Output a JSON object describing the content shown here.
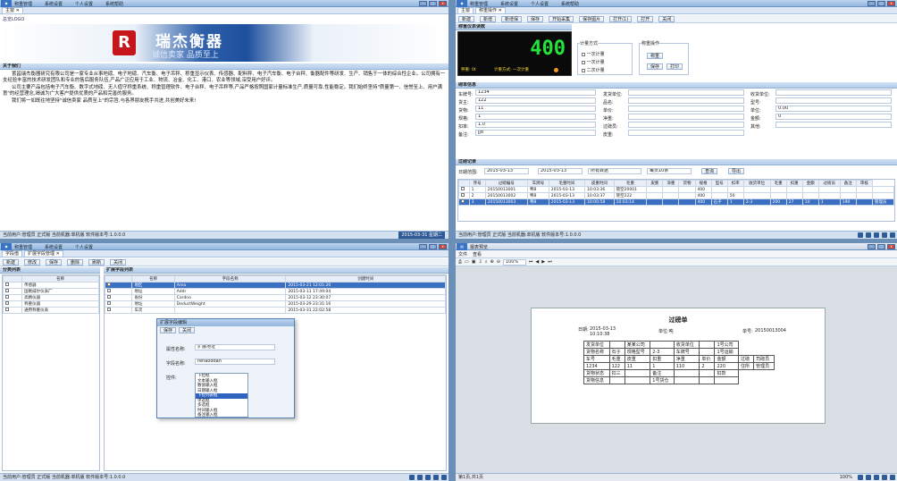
{
  "q1": {
    "menu": [
      "称重管理",
      "系统设置",
      "个人设置",
      "系统帮助"
    ],
    "tab": "主窗 ✕",
    "breadcrumb": "总览LOGO",
    "brand": "瑞杰衡器",
    "slogan": "诚信卖家 品质至上",
    "about": "关于我们",
    "p1": "置昌瑞杰衡器研究有限公司是一家专业从事地磅、电子地磅、汽车衡、电子吊秤、称重显示仪表、传感器、配料秤、电子汽车衡、电子台秤、衡器配件等研发、生产、销售于一体的综合性企业。公司拥有一支经验丰富的技术研发团队和专业的售后服务队伍,产品广泛应用于工业、物流、冶金、化工、港口、农业等领域,深受用户好评。",
    "p2": "公司主要产品包括电子汽车衡、数字式地磅、无人值守称重系统、称重管理软件、电子台秤、电子吊秤等,产品严格按照国家计量标准生产,质量可靠,性能稳定。我们始终坚持\"质量第一、信誉至上、用户满意\"的经营理念,竭诚为广大客户提供优质的产品和完善的服务。",
    "p3": "我们将一如既往地坚持\"诚信卖家 品质至上\"的宗旨,与各界朋友携手共进,共创美好未来!",
    "status": "当前用户:管理员 正式版 当前机器:单机版 软件版本号:1.0.0.0",
    "clock": "2015-03-31 星期二"
  },
  "q2": {
    "menu": [
      "称重管理",
      "系统设置",
      "个人设置",
      "系统帮助"
    ],
    "tabs": [
      "主窗",
      "称重操作 ✕"
    ],
    "toolbar": [
      "新建",
      "新增",
      "新增保",
      "保存",
      "开始采集",
      "保存图片",
      "打开(1)",
      "打开",
      "关闭"
    ],
    "weighing": "称重仪表读数",
    "weight": "400",
    "scale": "秤重: 0t",
    "mode": "计重方式: 一次计重",
    "modes": {
      "t": "计量方式",
      "a": "一次计量",
      "b": "一次计量",
      "c": "二次计量"
    },
    "ops": {
      "t": "称重操作",
      "a": "称重",
      "b": "保存",
      "c": "打印"
    },
    "form_title": "磅单信息",
    "f": {
      "chepai": "车牌号:",
      "chepai_v": "1234",
      "huozhu": "货主:",
      "huozhu_v": "122",
      "huowu": "货物:",
      "huowu_v": "11",
      "guige": "规格:",
      "guige_v": "1",
      "koulv": "扣率:",
      "koulv_v": "1.0",
      "beizhu": "备注:",
      "beizhu_v": "jjd",
      "fahuo": "发货单位:",
      "pinming": "品名:",
      "shouhuo": "收货单位:",
      "danjia": "单价:",
      "jingzhong": "净重:",
      "maozhong": "毛重:",
      "pizhong": "皮重:",
      "guobang": "过磅员:",
      "shouhuodw": "收货单位:",
      "xinghao": "型号:",
      "danwei": "单位:",
      "danwei_v": "0.00",
      "jine": "金额:",
      "jine_v": "0",
      "lianxi": "联系:",
      "lianxi_v": "",
      "qita": "其他:"
    },
    "list_title": "过磅记录",
    "filter": {
      "date_lbl": "日期范围:",
      "d1": "2015-03-13",
      "d2": "2015-03-13",
      "state": "所有数据",
      "page": "每页10条",
      "search": "查询",
      "export": "导出"
    },
    "cols": [
      "",
      "序号",
      "过磅编号",
      "车牌号",
      "毛重时间",
      "皮重时间",
      "毛重",
      "皮重",
      "净重",
      "货物",
      "规格",
      "型号",
      "扣率",
      "收货单位",
      "毛重",
      "扣重",
      "金额",
      "过磅员",
      "备注",
      "审核"
    ],
    "rows": [
      [
        "1",
        "20150013001",
        "粤B",
        "2015-03-13",
        "10:03:36",
        "管空20001",
        "",
        "",
        "",
        "400",
        "",
        "",
        "",
        "",
        "",
        "",
        "",
        "",
        "",
        ""
      ],
      [
        "2",
        "20150013002",
        "粤B",
        "2015-03-13",
        "10:03:37",
        "管空222",
        "",
        "",
        "",
        "400",
        "",
        "50",
        "",
        "",
        "",
        "",
        "",
        "",
        "",
        ""
      ],
      [
        "3",
        "20150013003",
        "粤B",
        "2015-03-13",
        "10:00:58",
        "10:03:14",
        "",
        "",
        "",
        "400",
        "石子",
        "1",
        "2-3",
        "200",
        "27",
        "10",
        "1",
        "190",
        "",
        "管理员"
      ]
    ],
    "status": "当前用户:管理员 正式版 当前机器:单机版 软件版本号:1.0.0.0"
  },
  "q3": {
    "menu": [
      "称重管理",
      "系统设置",
      "个人设置"
    ],
    "tabs": [
      "字段值",
      "扩展字段管理 ✕"
    ],
    "toolbar": [
      "新建",
      "修改",
      "保存",
      "删除",
      "刷新",
      "关闭"
    ],
    "left_title": "分类列表",
    "left_cols": [
      "",
      "名称"
    ],
    "left_rows": [
      "传感器",
      "国衡威尔仪表厂",
      "高精仪器",
      "称重仪器",
      "通用称重仪表"
    ],
    "right_title": "扩展字段列表",
    "right_cols": [
      "",
      "名称",
      "字段名称",
      "创建时间"
    ],
    "right_rows": [
      [
        "地区",
        "Area",
        "2015-03-21 12:01:20"
      ],
      [
        "地址",
        "Addr",
        "2015-03-11 17:49:04"
      ],
      [
        "省份",
        "Cardno",
        "2015-03-12 23:30:07"
      ],
      [
        "地址",
        "DeductWeight",
        "2015-03-29 23:31:16"
      ],
      [
        "车次",
        "",
        "2015-03-31 22:02:58"
      ]
    ],
    "dialog": {
      "title": "扩展字段编辑",
      "save": "保存",
      "close": "关闭",
      "f1": "属性名称:",
      "v1": "扩展地址",
      "f2": "字段名称:",
      "v2": "rehaoddan",
      "f3": "控件:",
      "options": [
        "下拉框",
        "文本输入框",
        "数值输入框",
        "日期输入框",
        "下拉列表框",
        "单选框",
        "多选框",
        "时间输入框",
        "备注输入框"
      ],
      "selected": 4
    },
    "status": "当前用户:管理员 正式版 当前机器:单机版 软件版本号:1.0.0.0"
  },
  "q4": {
    "title": "报表预览",
    "menu": [
      "文件",
      "查看"
    ],
    "zoom": "100%",
    "r_title": "过磅单",
    "date_lbl": "日期:",
    "date_v": "2015-03-13",
    "time_v": "10:10:38",
    "unit_lbl": "单位:吨",
    "no_lbl": "单号:",
    "no_v": "20150013004",
    "rows": [
      [
        "发货单位",
        "",
        "某某公司",
        "",
        "收货单位",
        "",
        "1号公司"
      ],
      [
        "货物名称",
        "石子",
        "规格型号",
        "2-3",
        "车牌号",
        "",
        "1号运输"
      ],
      [
        "车号",
        "毛重",
        "皮重",
        "扣重",
        "净重",
        "单价",
        "金额",
        "过磅",
        "司磅员"
      ],
      [
        "1234",
        "122",
        "11",
        "1",
        "110",
        "2",
        "220",
        "住所",
        "管理员"
      ],
      [
        "货物状态",
        "扣三",
        "",
        "备注",
        "",
        "",
        "扣款"
      ],
      [
        "货物信息",
        "",
        "",
        "1号货仓",
        "",
        "",
        ""
      ]
    ],
    "status": "第1页,共1页",
    "zoompct": "100%"
  }
}
